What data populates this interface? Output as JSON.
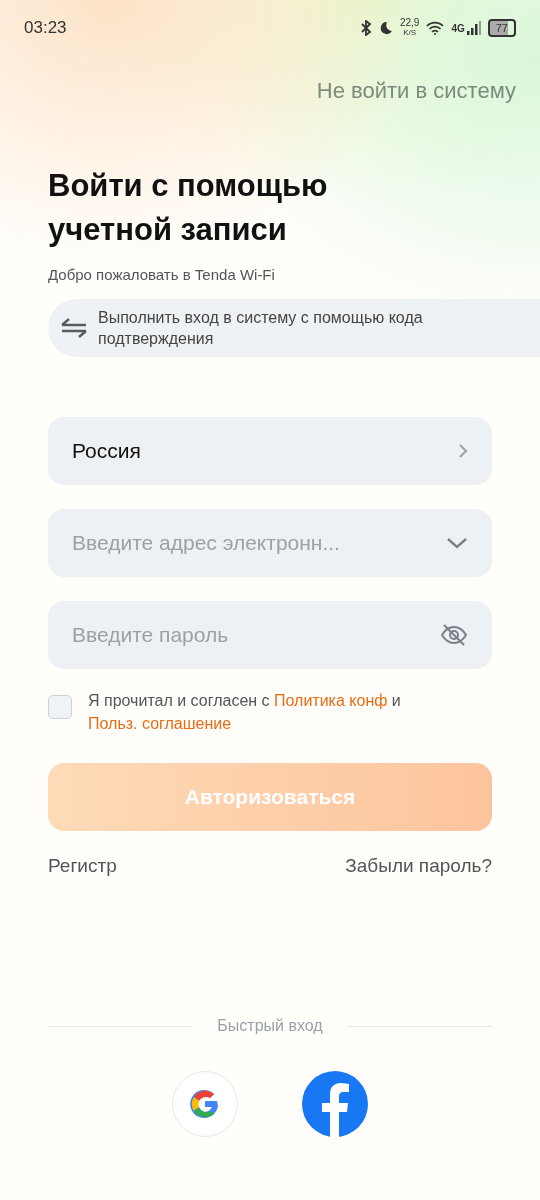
{
  "status_bar": {
    "time": "03:23",
    "speed_value": "22,9",
    "speed_unit": "K/S",
    "network": "4G",
    "battery": "77"
  },
  "skip_link": "Не войти в систему",
  "title": "Войти с помощью учетной записи",
  "subtitle": "Добро пожаловать в Tenda Wi-Fi",
  "code_login_button": "Выполнить вход в систему с помощью кода подтверждения",
  "country_field": {
    "value": "Россия"
  },
  "email_field": {
    "placeholder": "Введите адрес электронн..."
  },
  "password_field": {
    "placeholder": "Введите пароль"
  },
  "agreement": {
    "checked": false,
    "text_before": "Я прочитал и согласен с",
    "privacy_link": "Политика конф",
    "text_middle": "и",
    "terms_link": "Польз. соглашение"
  },
  "login_button": {
    "label": "Авторизоваться",
    "disabled": true
  },
  "register_link": "Регистр",
  "forgot_link": "Забыли пароль?",
  "quick_login": {
    "label": "Быстрый вход",
    "providers": [
      {
        "kind": "google"
      },
      {
        "kind": "facebook"
      }
    ]
  }
}
